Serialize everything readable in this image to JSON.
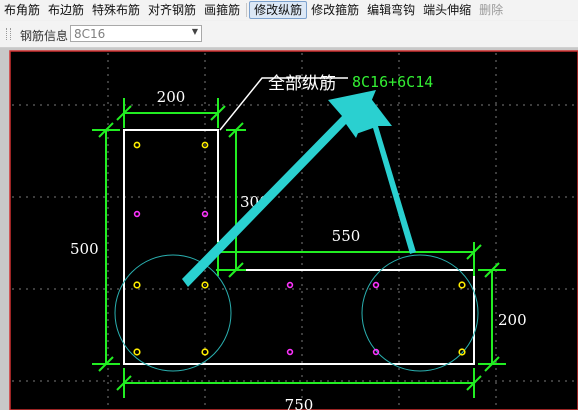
{
  "toolbar": {
    "items": [
      {
        "label": "布角筋"
      },
      {
        "label": "布边筋"
      },
      {
        "label": "特殊布筋"
      },
      {
        "label": "对齐钢筋"
      },
      {
        "label": "画箍筋"
      },
      {
        "label": "修改纵筋"
      },
      {
        "label": "修改箍筋"
      },
      {
        "label": "编辑弯钩"
      },
      {
        "label": "端头伸缩"
      },
      {
        "label": "删除"
      }
    ]
  },
  "rebar_info": {
    "label": "钢筋信息",
    "value": "8C16"
  },
  "drawing": {
    "annotation_label": "全部纵筋",
    "annotation_value": "8C16+6C14",
    "dimensions": {
      "top_width": "200",
      "left_height": "500",
      "inner_height": "300",
      "flange_width": "550",
      "right_height": "200",
      "bottom_width": "750"
    },
    "colors": {
      "background": "#000000",
      "outline": "#ffffff",
      "dimension_line": "#22ee22",
      "arrow": "#2ad0d0",
      "corner_bar": "#ffee00",
      "side_bar": "#ff33ff"
    }
  }
}
